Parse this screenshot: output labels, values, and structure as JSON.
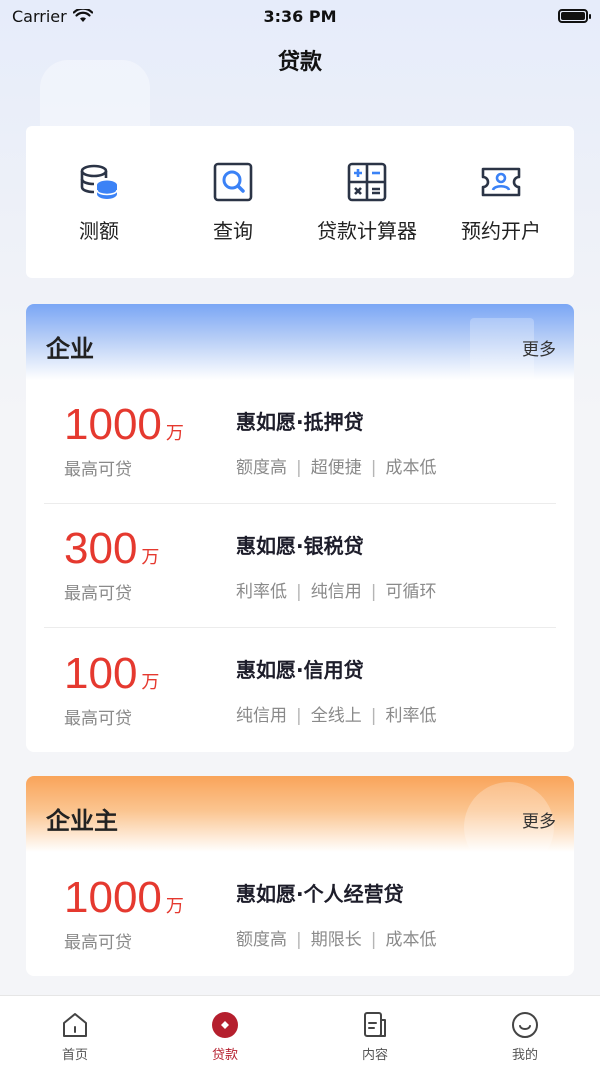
{
  "status_bar": {
    "carrier": "Carrier",
    "time": "3:36 PM"
  },
  "header": {
    "title": "贷款"
  },
  "quick_actions": [
    {
      "label": "测额",
      "icon": "database-icon"
    },
    {
      "label": "查询",
      "icon": "search-doc-icon"
    },
    {
      "label": "贷款计算器",
      "icon": "calculator-icon"
    },
    {
      "label": "预约开户",
      "icon": "id-card-icon"
    }
  ],
  "sections": [
    {
      "title": "企业",
      "more": "更多",
      "products": [
        {
          "amount": "1000",
          "unit": "万",
          "sub": "最高可贷",
          "name": "惠如愿·抵押贷",
          "tags": [
            "额度高",
            "超便捷",
            "成本低"
          ]
        },
        {
          "amount": "300",
          "unit": "万",
          "sub": "最高可贷",
          "name": "惠如愿·银税贷",
          "tags": [
            "利率低",
            "纯信用",
            "可循环"
          ]
        },
        {
          "amount": "100",
          "unit": "万",
          "sub": "最高可贷",
          "name": "惠如愿·信用贷",
          "tags": [
            "纯信用",
            "全线上",
            "利率低"
          ]
        }
      ]
    },
    {
      "title": "企业主",
      "more": "更多",
      "products": [
        {
          "amount": "1000",
          "unit": "万",
          "sub": "最高可贷",
          "name": "惠如愿·个人经营贷",
          "tags": [
            "额度高",
            "期限长",
            "成本低"
          ]
        }
      ]
    }
  ],
  "tabs": [
    {
      "label": "首页",
      "icon": "home-icon",
      "active": false
    },
    {
      "label": "贷款",
      "icon": "loan-icon",
      "active": true
    },
    {
      "label": "内容",
      "icon": "document-icon",
      "active": false
    },
    {
      "label": "我的",
      "icon": "smiley-icon",
      "active": false
    }
  ],
  "colors": {
    "accent_red": "#e5392f",
    "tab_active": "#b51f2e",
    "icon_blue": "#3b82f6"
  }
}
